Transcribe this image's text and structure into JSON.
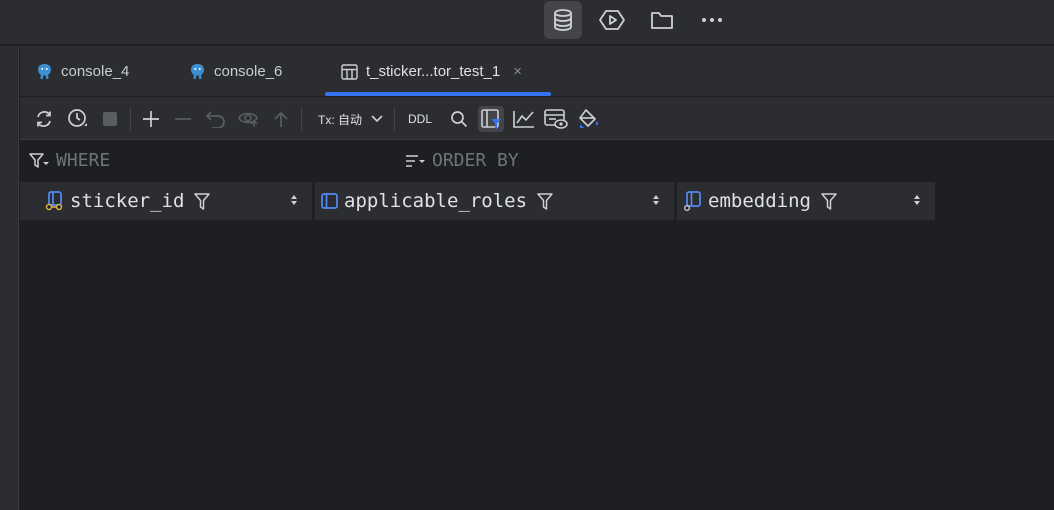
{
  "tabs": [
    {
      "label": "console_4",
      "icon": "postgres-icon",
      "active": false
    },
    {
      "label": "console_6",
      "icon": "postgres-icon",
      "active": false
    },
    {
      "label": "t_sticker...tor_test_1",
      "icon": "table-icon",
      "active": true,
      "close": "×"
    }
  ],
  "toolbar": {
    "tx_label": "Tx: 自动",
    "ddl_label": "DDL"
  },
  "filter": {
    "where_label": "WHERE",
    "order_by_label": "ORDER BY"
  },
  "columns": [
    {
      "name": "sticker_id",
      "icon": "primary-key-column-icon"
    },
    {
      "name": "applicable_roles",
      "icon": "column-icon"
    },
    {
      "name": "embedding",
      "icon": "column-icon"
    }
  ],
  "colors": {
    "accent": "#3574f0",
    "background": "#1e1f22",
    "panel": "#2b2d30"
  }
}
